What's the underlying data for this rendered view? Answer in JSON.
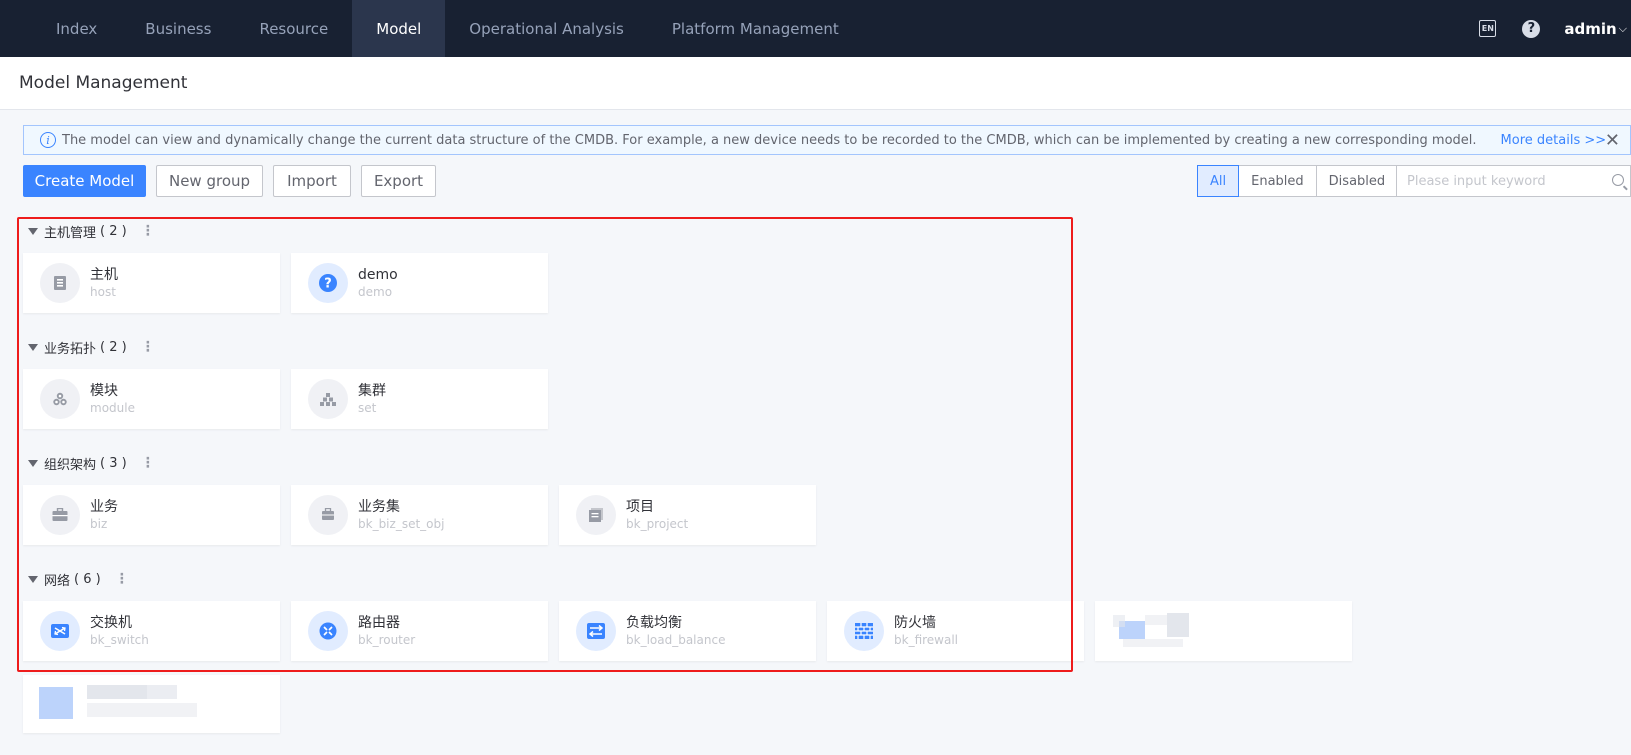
{
  "nav": {
    "items": [
      {
        "label": "Index"
      },
      {
        "label": "Business"
      },
      {
        "label": "Resource"
      },
      {
        "label": "Model",
        "active": true
      },
      {
        "label": "Operational Analysis"
      },
      {
        "label": "Platform Management"
      }
    ],
    "lang_label": "EN",
    "help_label": "?",
    "user": "admin"
  },
  "header": {
    "title": "Model Management"
  },
  "banner": {
    "text": "The model can view and dynamically change the current data structure of the CMDB. For example, a new device needs to be recorded to the CMDB, which can be implemented by creating a new corresponding model.",
    "link": "More details >>",
    "close": "✕"
  },
  "toolbar": {
    "create": "Create Model",
    "new_group": "New group",
    "import": "Import",
    "export": "Export",
    "filters": [
      "All",
      "Enabled",
      "Disabled"
    ],
    "active_filter": "All",
    "search_placeholder": "Please input keyword"
  },
  "groups": [
    {
      "name": "主机管理",
      "count": "( 2 )",
      "models": [
        {
          "name": "主机",
          "id": "host",
          "icon": "host-icon"
        },
        {
          "name": "demo",
          "id": "demo",
          "icon": "question-icon"
        }
      ]
    },
    {
      "name": "业务拓扑",
      "count": "( 2 )",
      "models": [
        {
          "name": "模块",
          "id": "module",
          "icon": "module-icon"
        },
        {
          "name": "集群",
          "id": "set",
          "icon": "set-icon"
        }
      ]
    },
    {
      "name": "组织架构",
      "count": "( 3 )",
      "models": [
        {
          "name": "业务",
          "id": "biz",
          "icon": "briefcase-icon"
        },
        {
          "name": "业务集",
          "id": "bk_biz_set_obj",
          "icon": "briefcase-set-icon"
        },
        {
          "name": "项目",
          "id": "bk_project",
          "icon": "project-icon"
        }
      ]
    },
    {
      "name": "网络",
      "count": "( 6 )",
      "models": [
        {
          "name": "交换机",
          "id": "bk_switch",
          "icon": "switch-icon"
        },
        {
          "name": "路由器",
          "id": "bk_router",
          "icon": "router-icon"
        },
        {
          "name": "负载均衡",
          "id": "bk_load_balance",
          "icon": "load-balance-icon"
        },
        {
          "name": "防火墙",
          "id": "bk_firewall",
          "icon": "firewall-icon"
        }
      ]
    }
  ],
  "colors": {
    "nav_bg": "#182132",
    "accent": "#3a84ff",
    "highlight": "#ee1c1c"
  }
}
